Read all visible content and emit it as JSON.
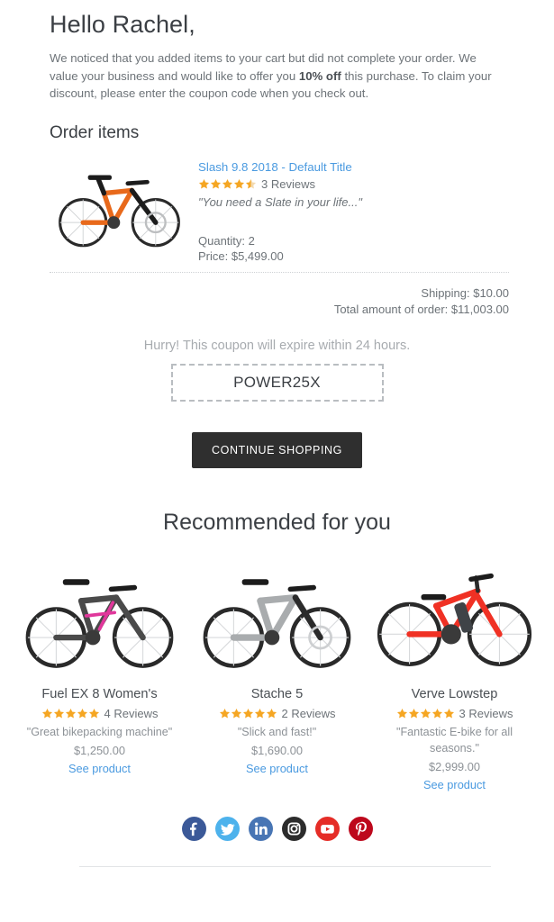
{
  "greeting": {
    "title": "Hello Rachel,",
    "body_part1": "We noticed that you added items to your cart but did not complete your order. We value your business and would like to offer you ",
    "body_highlight": "10% off",
    "body_part2": " this purchase. To claim your discount, please enter the coupon code when you check out."
  },
  "order": {
    "heading": "Order items",
    "item": {
      "title": "Slash 9.8 2018 - Default Title",
      "rating": 4.5,
      "reviews": "3 Reviews",
      "quote": "\"You need a Slate in your life...\"",
      "quantity": "Quantity: 2",
      "price": "Price: $5,499.00",
      "image_alt": "orange-mountain-bike"
    },
    "totals": {
      "shipping": "Shipping: $10.00",
      "total": "Total amount of order: $11,003.00"
    }
  },
  "coupon": {
    "note": "Hurry! This coupon will expire within 24 hours.",
    "code": "POWER25X"
  },
  "cta": {
    "label": "CONTINUE SHOPPING"
  },
  "recommended": {
    "heading": "Recommended for you",
    "products": [
      {
        "name": "Fuel EX 8 Women's",
        "rating": 5,
        "reviews": "4 Reviews",
        "quote": "\"Great bikepacking machine\"",
        "price": "$1,250.00",
        "link_label": "See product",
        "image_alt": "gray-pink-mountain-bike"
      },
      {
        "name": "Stache 5",
        "rating": 5,
        "reviews": "2 Reviews",
        "quote": "\"Slick and fast!\"",
        "price": "$1,690.00",
        "link_label": "See product",
        "image_alt": "silver-hardtail-bike"
      },
      {
        "name": "Verve Lowstep",
        "rating": 5,
        "reviews": "3 Reviews",
        "quote": "\"Fantastic E-bike for all seasons.\"",
        "price": "$2,999.00",
        "link_label": "See product",
        "image_alt": "red-electric-step-through-bike"
      }
    ]
  },
  "social": [
    {
      "name": "facebook-icon",
      "color": "#3b5998"
    },
    {
      "name": "twitter-icon",
      "color": "#4db2ec"
    },
    {
      "name": "linkedin-icon",
      "color": "#4875b4"
    },
    {
      "name": "instagram-icon",
      "color": "#2c2c2c"
    },
    {
      "name": "youtube-icon",
      "color": "#e52d27"
    },
    {
      "name": "pinterest-icon",
      "color": "#bd081c"
    }
  ],
  "colors": {
    "link": "#4a9ae0",
    "star": "#f5a623",
    "star_empty": "#f3d9ad",
    "cta_bg": "#2f2f2f",
    "heading": "#3b3f44",
    "body_text": "#6d7378"
  }
}
